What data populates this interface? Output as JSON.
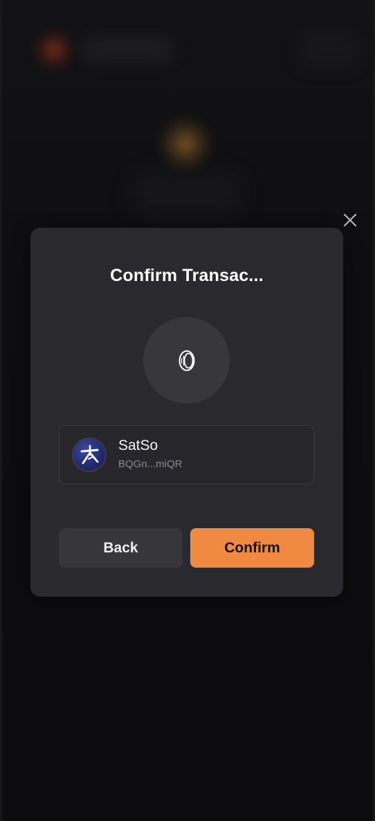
{
  "modal": {
    "title": "Confirm Transac...",
    "token_icon": "coin-icon",
    "account": {
      "name": "SatSo",
      "address": "BQGn...miQR",
      "avatar_icon": "satso-logo-icon"
    },
    "back_label": "Back",
    "confirm_label": "Confirm",
    "close_icon": "close-icon"
  },
  "colors": {
    "accent": "#f08a42",
    "modal_bg": "#29292e",
    "backdrop": "#0d0d0f"
  }
}
